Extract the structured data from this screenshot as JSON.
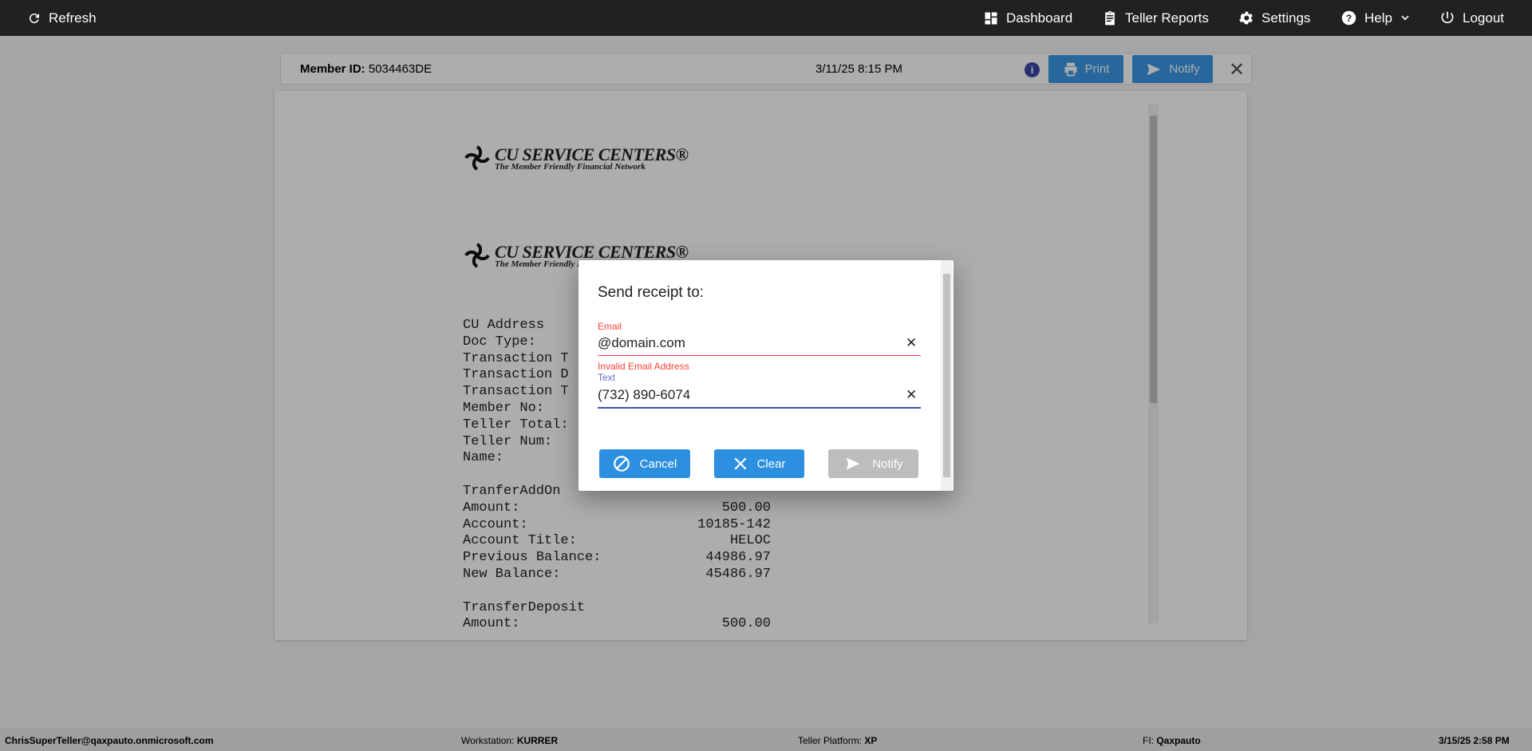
{
  "topbar": {
    "refresh": "Refresh",
    "dashboard": "Dashboard",
    "teller_reports": "Teller Reports",
    "settings": "Settings",
    "help": "Help",
    "logout": "Logout"
  },
  "member_header": {
    "member_id_label": "Member ID:",
    "member_id": "5034463DE",
    "date": "3/11/25 8:15 PM",
    "print": "Print",
    "notify": "Notify"
  },
  "receipt": {
    "logo_title": "CU SERVICE CENTERS®",
    "logo_tagline": "The Member Friendly Financial Network",
    "lines": [
      {
        "label": "CU Address",
        "value": ""
      },
      {
        "label": "Doc Type:",
        "value": ""
      },
      {
        "label": "Transaction T",
        "value": ""
      },
      {
        "label": "Transaction D",
        "value": ""
      },
      {
        "label": "Transaction T",
        "value": ""
      },
      {
        "label": "Member No:",
        "value": ""
      },
      {
        "label": "Teller Total:",
        "value": ""
      },
      {
        "label": "Teller Num:",
        "value": ""
      },
      {
        "label": "Name:",
        "value": ""
      },
      {
        "label": "",
        "value": ""
      },
      {
        "label": "TranferAddOn",
        "value": ""
      },
      {
        "label": "Amount:",
        "value": "500.00"
      },
      {
        "label": "Account:",
        "value": "10185-142"
      },
      {
        "label": "Account Title:",
        "value": "HELOC"
      },
      {
        "label": "Previous Balance:",
        "value": "44986.97"
      },
      {
        "label": "New Balance:",
        "value": "45486.97"
      },
      {
        "label": "",
        "value": ""
      },
      {
        "label": "TransferDeposit",
        "value": ""
      },
      {
        "label": "Amount:",
        "value": "500.00"
      }
    ]
  },
  "dialog": {
    "title": "Send receipt to:",
    "email_label": "Email",
    "email_value": "@domain.com",
    "email_error": "Invalid Email Address",
    "text_label": "Text",
    "text_value": "(732) 890-6074",
    "cancel": "Cancel",
    "clear": "Clear",
    "notify": "Notify"
  },
  "footer": {
    "user": "ChrisSuperTeller@qaxpauto.onmicrosoft.com",
    "workstation_label": "Workstation:",
    "workstation": "KURRER",
    "platform_label": "Teller Platform:",
    "platform": "XP",
    "fi_label": "FI:",
    "fi": "Qaxpauto",
    "datetime": "3/15/25 2:58 PM"
  },
  "colors": {
    "error": "#f44336",
    "focus": "#3f51b5",
    "button": "#3c98e6",
    "disabled": "#bdbdbd"
  }
}
